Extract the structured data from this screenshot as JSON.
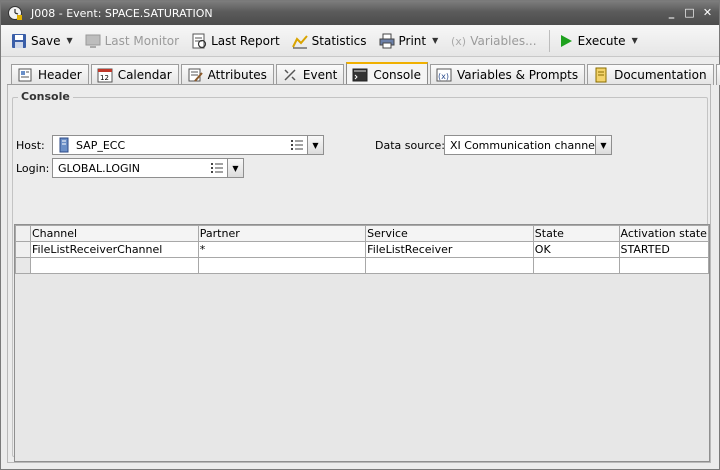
{
  "window": {
    "title": "J008 - Event: SPACE.SATURATION"
  },
  "toolbar": {
    "save": "Save",
    "last_monitor": "Last Monitor",
    "last_report": "Last Report",
    "statistics": "Statistics",
    "print": "Print",
    "variables": "Variables...",
    "execute": "Execute"
  },
  "tabs": [
    {
      "label": "Header"
    },
    {
      "label": "Calendar"
    },
    {
      "label": "Attributes"
    },
    {
      "label": "Event"
    },
    {
      "label": "Console"
    },
    {
      "label": "Variables & Prompts"
    },
    {
      "label": "Documentation"
    }
  ],
  "console": {
    "group_title": "Console",
    "host_label": "Host:",
    "host_value": "SAP_ECC",
    "login_label": "Login:",
    "login_value": "GLOBAL.LOGIN",
    "datasource_label": "Data source:",
    "datasource_value": "XI Communication channels"
  },
  "table": {
    "columns": [
      "Channel",
      "Partner",
      "Service",
      "State",
      "Activation state"
    ],
    "rows": [
      [
        "FileListReceiverChannel",
        "*",
        "FileListReceiver",
        "OK",
        "STARTED"
      ]
    ]
  }
}
